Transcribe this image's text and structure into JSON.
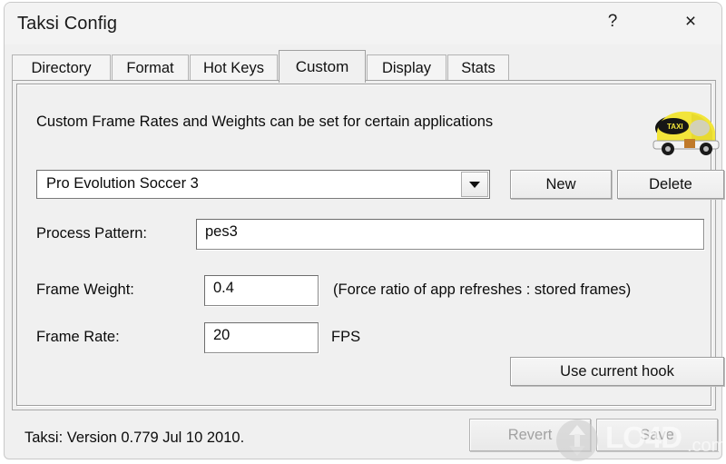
{
  "window": {
    "title": "Taksi Config",
    "help_label": "?",
    "close_label": "×"
  },
  "tabs": [
    {
      "label": "Directory",
      "active": false
    },
    {
      "label": "Format",
      "active": false
    },
    {
      "label": "Hot Keys",
      "active": false
    },
    {
      "label": "Custom",
      "active": true
    },
    {
      "label": "Display",
      "active": false
    },
    {
      "label": "Stats",
      "active": false
    }
  ],
  "panel": {
    "heading": "Custom Frame Rates and Weights can be set for certain applications",
    "logo_name": "taksi-taxi-logo",
    "application_combo": {
      "value": "Pro Evolution Soccer 3",
      "arrow": "chevron-down-icon"
    },
    "new_button": "New",
    "delete_button": "Delete",
    "process_pattern": {
      "label": "Process Pattern:",
      "value": "pes3"
    },
    "frame_weight": {
      "label": "Frame Weight:",
      "value": "0.4",
      "hint": "(Force ratio of app refreshes : stored frames)"
    },
    "frame_rate": {
      "label": "Frame Rate:",
      "value": "20",
      "unit": "FPS"
    },
    "use_current_hook_button": "Use current hook"
  },
  "statusbar": {
    "version_text": "Taksi: Version 0.779 Jul 10 2010.",
    "revert_button": "Revert",
    "save_button": "Save"
  },
  "watermark": {
    "text": "LO4D",
    "suffix": ".com"
  },
  "colors": {
    "window_bg": "#f0f0f0",
    "titlebar_bg": "#f3f3f3",
    "border": "#a8a8a8",
    "text": "#0b0b0b",
    "disabled_text": "#a2a2a2",
    "field_bg": "#ffffff",
    "logo_yellow": "#f2e53a"
  }
}
